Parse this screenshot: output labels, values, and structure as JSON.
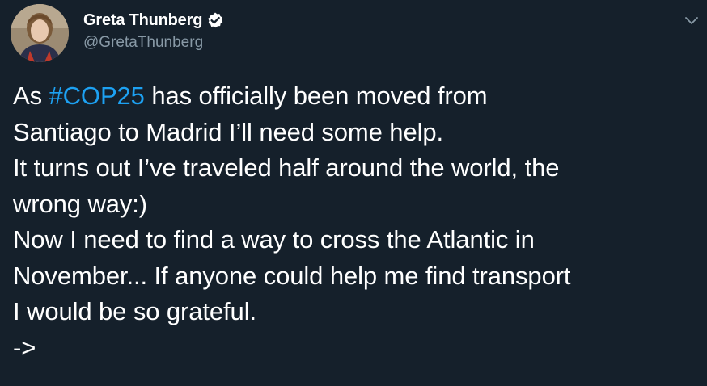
{
  "author": {
    "display_name": "Greta Thunberg",
    "handle": "@GretaThunberg",
    "verified": true,
    "avatar_icon": "profile-photo"
  },
  "tweet": {
    "line1_pre": "As ",
    "hashtag": "#COP25",
    "line1_post": " has officially been moved from",
    "line2": "Santiago to Madrid I’ll need some help.",
    "line3": "It turns out I’ve traveled half around the world, the",
    "line4": "wrong way:)",
    "line5": "Now I need to find a way to cross the Atlantic in",
    "line6": "November... If anyone could help me find transport",
    "line7": "I would be so grateful.",
    "line8": "->"
  },
  "icons": {
    "verified": "verified-badge-icon",
    "menu": "chevron-down-icon"
  },
  "colors": {
    "background": "#15202b",
    "text": "#ffffff",
    "secondary": "#8899a6",
    "accent": "#1da1f2"
  }
}
